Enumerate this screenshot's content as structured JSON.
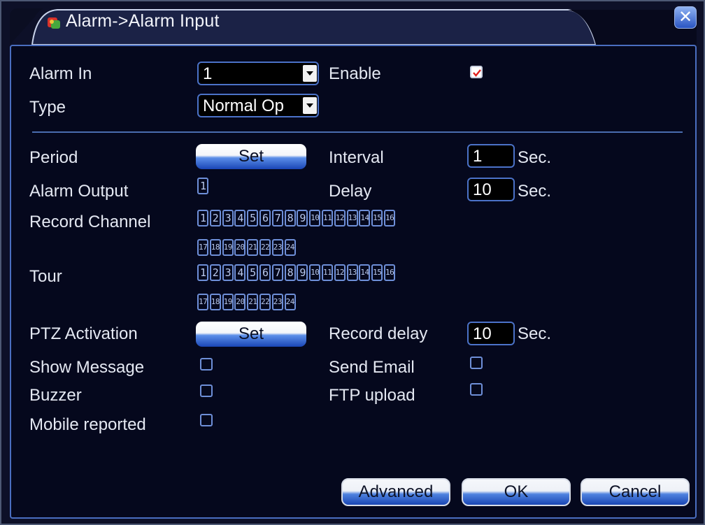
{
  "window": {
    "title": "Alarm->Alarm Input",
    "close_symbol": "✕"
  },
  "alarm_in": {
    "label": "Alarm In",
    "value": "1"
  },
  "enable": {
    "label": "Enable",
    "checked": true
  },
  "type": {
    "label": "Type",
    "value": "Normal Op"
  },
  "period": {
    "label": "Period",
    "button": "Set"
  },
  "interval": {
    "label": "Interval",
    "value": "1",
    "unit": "Sec."
  },
  "alarm_output": {
    "label": "Alarm Output",
    "channels": [
      "1"
    ]
  },
  "delay": {
    "label": "Delay",
    "value": "10",
    "unit": "Sec."
  },
  "record_channel": {
    "label": "Record Channel",
    "row1": [
      "1",
      "2",
      "3",
      "4",
      "5",
      "6",
      "7",
      "8",
      "9",
      "10",
      "11",
      "12",
      "13",
      "14",
      "15",
      "16"
    ],
    "row2": [
      "17",
      "18",
      "19",
      "20",
      "21",
      "22",
      "23",
      "24"
    ]
  },
  "tour": {
    "label": "Tour",
    "row1": [
      "1",
      "2",
      "3",
      "4",
      "5",
      "6",
      "7",
      "8",
      "9",
      "10",
      "11",
      "12",
      "13",
      "14",
      "15",
      "16"
    ],
    "row2": [
      "17",
      "18",
      "19",
      "20",
      "21",
      "22",
      "23",
      "24"
    ]
  },
  "ptz_activation": {
    "label": "PTZ Activation",
    "button": "Set"
  },
  "record_delay": {
    "label": "Record delay",
    "value": "10",
    "unit": "Sec."
  },
  "show_message": {
    "label": "Show Message",
    "checked": false
  },
  "send_email": {
    "label": "Send Email",
    "checked": false
  },
  "buzzer": {
    "label": "Buzzer",
    "checked": false
  },
  "ftp_upload": {
    "label": "FTP upload",
    "checked": false
  },
  "mobile_reported": {
    "label": "Mobile reported",
    "checked": false
  },
  "footer": {
    "advanced": "Advanced",
    "ok": "OK",
    "cancel": "Cancel"
  },
  "colors": {
    "background": "#05081d",
    "border": "#4a6ec0",
    "accent": "#1a46b6",
    "check": "#e0201e"
  }
}
